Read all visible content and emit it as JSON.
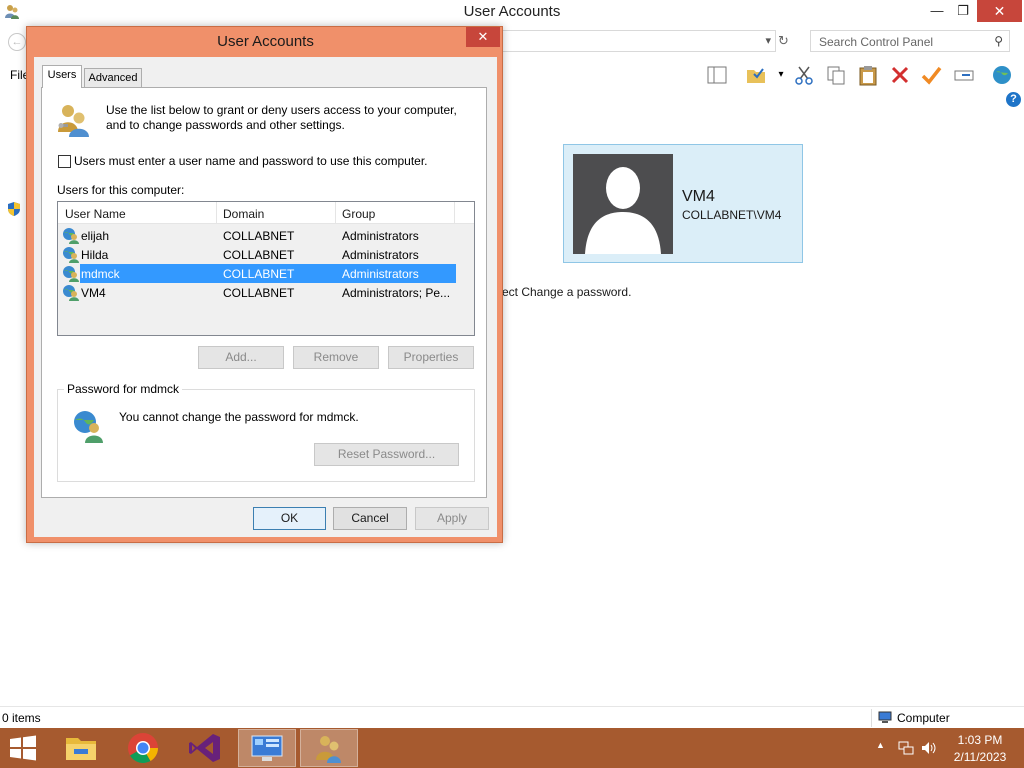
{
  "window": {
    "title": "User Accounts",
    "min_label": "—",
    "max_label": "❐",
    "close_label": "✕",
    "search_placeholder": "Search Control Panel",
    "menu_file": "File",
    "hint_text": "ect Change a password.",
    "user_tile": {
      "name": "VM4",
      "domain": "COLLABNET\\VM4"
    },
    "status_items": "0 items",
    "status_location": "Computer"
  },
  "dialog": {
    "title": "User Accounts",
    "close_label": "✕",
    "tabs": [
      {
        "label": "Users",
        "selected": true
      },
      {
        "label": "Advanced",
        "selected": false
      }
    ],
    "intro_text": "Use the list below to grant or deny users access to your computer, and to change passwords and other settings.",
    "require_login_label": "Users must enter a user name and password to use this computer.",
    "require_login_checked": false,
    "users_label": "Users for this computer:",
    "columns": [
      "User Name",
      "Domain",
      "Group"
    ],
    "users": [
      {
        "name": "elijah",
        "domain": "COLLABNET",
        "group": "Administrators"
      },
      {
        "name": "Hilda",
        "domain": "COLLABNET",
        "group": "Administrators"
      },
      {
        "name": "mdmck",
        "domain": "COLLABNET",
        "group": "Administrators",
        "selected": true
      },
      {
        "name": "VM4",
        "domain": "COLLABNET",
        "group": "Administrators; Pe..."
      }
    ],
    "buttons": {
      "add": "Add...",
      "remove": "Remove",
      "properties": "Properties"
    },
    "password_group_label": "Password for mdmck",
    "password_message": "You cannot change the password for mdmck.",
    "reset_password_label": "Reset Password...",
    "ok_label": "OK",
    "cancel_label": "Cancel",
    "apply_label": "Apply"
  },
  "taskbar": {
    "apps": [
      "file-explorer",
      "chrome",
      "visual-studio",
      "remote-desktop",
      "user-accounts"
    ],
    "active_app": "user-accounts",
    "time": "1:03 PM",
    "date": "2/11/2023"
  },
  "colors": {
    "dialog_frame": "#f0906a",
    "taskbar": "#a65a2f",
    "selection": "#3399ff",
    "close_red": "#c7463b",
    "tile_bg": "#dbeef8"
  }
}
